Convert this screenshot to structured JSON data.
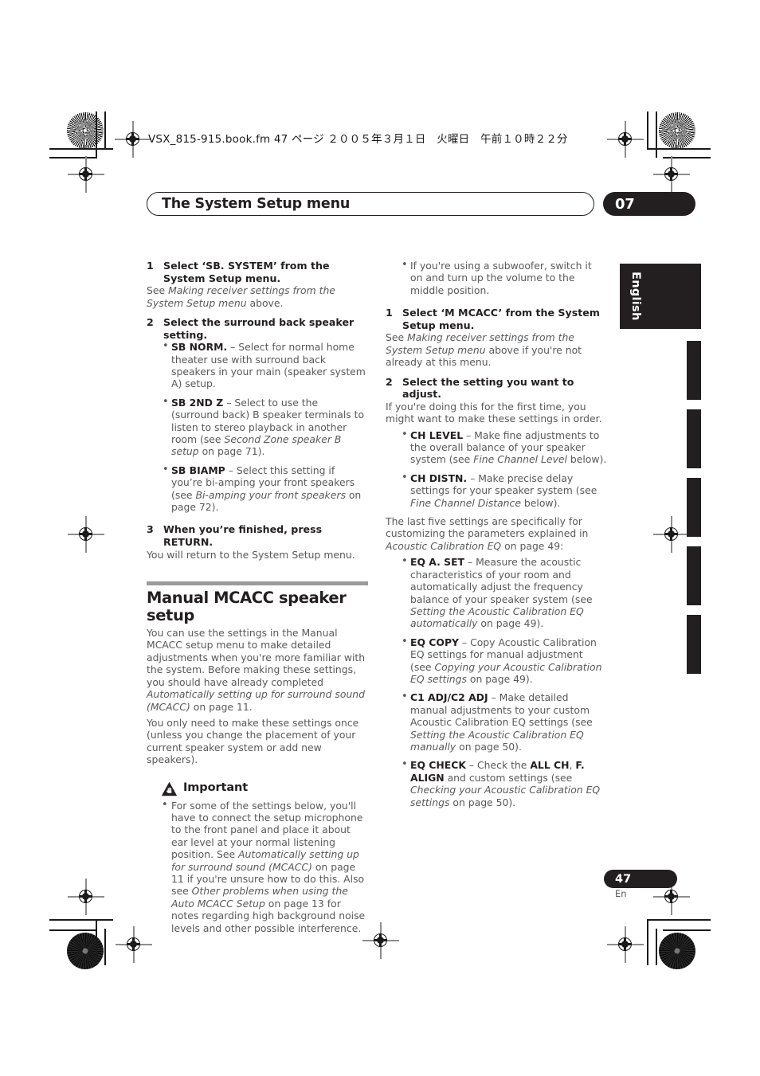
{
  "slug_line": "VSX_815-915.book.fm  47 ページ  ２００５年３月１日　火曜日　午前１０時２２分",
  "running_head": {
    "title": "The System Setup menu",
    "chapter_number": "07"
  },
  "side_tab": {
    "language": "English"
  },
  "footer": {
    "page_number": "47",
    "language_code": "En"
  },
  "colors": {
    "ink": "#231f20",
    "body_text": "#58595b",
    "rule_gray": "#9b9b9b"
  },
  "left_column": {
    "step1": {
      "number": "1",
      "title": "Select ‘SB. SYSTEM’ from the System Setup menu.",
      "body_pre": "See ",
      "body_italic": "Making receiver settings from the System Setup menu",
      "body_post": " above."
    },
    "step2": {
      "number": "2",
      "title": "Select the surround back speaker setting.",
      "bullets": [
        {
          "term": "SB NORM.",
          "dash": " – ",
          "text": "Select for normal home theater use with surround back speakers in your main (speaker system A) setup."
        },
        {
          "term": "SB 2ND Z",
          "dash": " – ",
          "text_pre": "Select to use the (surround back) B speaker terminals to listen to stereo playback in another room (see ",
          "italic": "Second Zone speaker B setup",
          "text_post": " on page 71)."
        },
        {
          "term": "SB BIAMP",
          "dash": " – ",
          "text_pre": "Select this setting if you’re bi-amping your front speakers (see ",
          "italic": "Bi-amping your front speakers",
          "text_post": " on page 72)."
        }
      ]
    },
    "step3": {
      "number": "3",
      "title": "When you’re finished, press RETURN.",
      "body": "You will return to the System Setup menu."
    },
    "section": {
      "heading": "Manual MCACC speaker setup",
      "para1_pre": "You can use the settings in the Manual MCACC setup menu to make detailed adjustments when you're more familiar with the system. Before making these settings, you should have already completed ",
      "para1_italic": "Automatically setting up for surround sound (MCACC)",
      "para1_post": " on page 11.",
      "para2": "You only need to make these settings once (unless you change the placement of your current speaker system or add new speakers)."
    },
    "important": {
      "label": "Important",
      "icon": "warning-triangle-icon",
      "bullets": [
        {
          "t1": "For some of the settings below, you'll have to connect the setup microphone to the front panel and place it about ear level at your normal listening position. See ",
          "i1": "Automatically setting up for surround sound (MCACC)",
          "t2": " on page 11 if you're unsure how to do this. Also see ",
          "i2": "Other problems when using the Auto MCACC Setup",
          "t3": " on page 13 for notes regarding high background noise levels and other possible interference."
        }
      ]
    }
  },
  "right_column": {
    "top_bullet": "If you're using a subwoofer, switch it on and turn up the volume to the middle position.",
    "step1": {
      "number": "1",
      "title": "Select ‘M MCACC’ from the System Setup menu.",
      "body_pre": "See ",
      "body_italic": "Making receiver settings from the System Setup menu",
      "body_post": " above if you're not already at this menu."
    },
    "step2": {
      "number": "2",
      "title": "Select the setting you want to adjust.",
      "body": "If you're doing this for the first time, you might want to make these settings in order.",
      "bullets": [
        {
          "term": "CH LEVEL",
          "dash": " – ",
          "text_pre": "Make fine adjustments to the overall balance of your speaker system (see ",
          "italic": "Fine Channel Level",
          "text_post": " below)."
        },
        {
          "term": "CH DISTN.",
          "dash": " – ",
          "text_pre": "Make precise delay settings for your speaker system (see ",
          "italic": "Fine Channel Distance",
          "text_post": " below)."
        }
      ]
    },
    "last_five_pre": "The last five settings are specifically for customizing the parameters explained in ",
    "last_five_italic": "Acoustic Calibration EQ",
    "last_five_post": " on page 49:",
    "eq_bullets": [
      {
        "term": "EQ A. SET",
        "dash": " – ",
        "text_pre": "Measure the acoustic characteristics of your room and automatically adjust the frequency balance of your speaker system (see ",
        "italic": "Setting the Acoustic Calibration EQ automatically",
        "text_post": " on page 49)."
      },
      {
        "term": "EQ COPY",
        "dash": " – ",
        "text_pre": "Copy Acoustic Calibration EQ settings for manual adjustment (see ",
        "italic": "Copying your Acoustic Calibration EQ settings",
        "text_post": " on page 49)."
      },
      {
        "term": "C1 ADJ/C2 ADJ",
        "dash": " – ",
        "text_pre": "Make detailed manual adjustments to your custom Acoustic Calibration EQ settings (see ",
        "italic": "Setting the Acoustic Calibration EQ manually",
        "text_post": " on page 50)."
      },
      {
        "term": "EQ CHECK",
        "dash": " – ",
        "text_pre": "Check the ",
        "bold_a": "ALL CH",
        "mid": ", ",
        "bold_b": "F. ALIGN",
        "text_mid": " and custom settings (see ",
        "italic": "Checking your Acoustic Calibration EQ settings",
        "text_post": " on page 50)."
      }
    ]
  }
}
